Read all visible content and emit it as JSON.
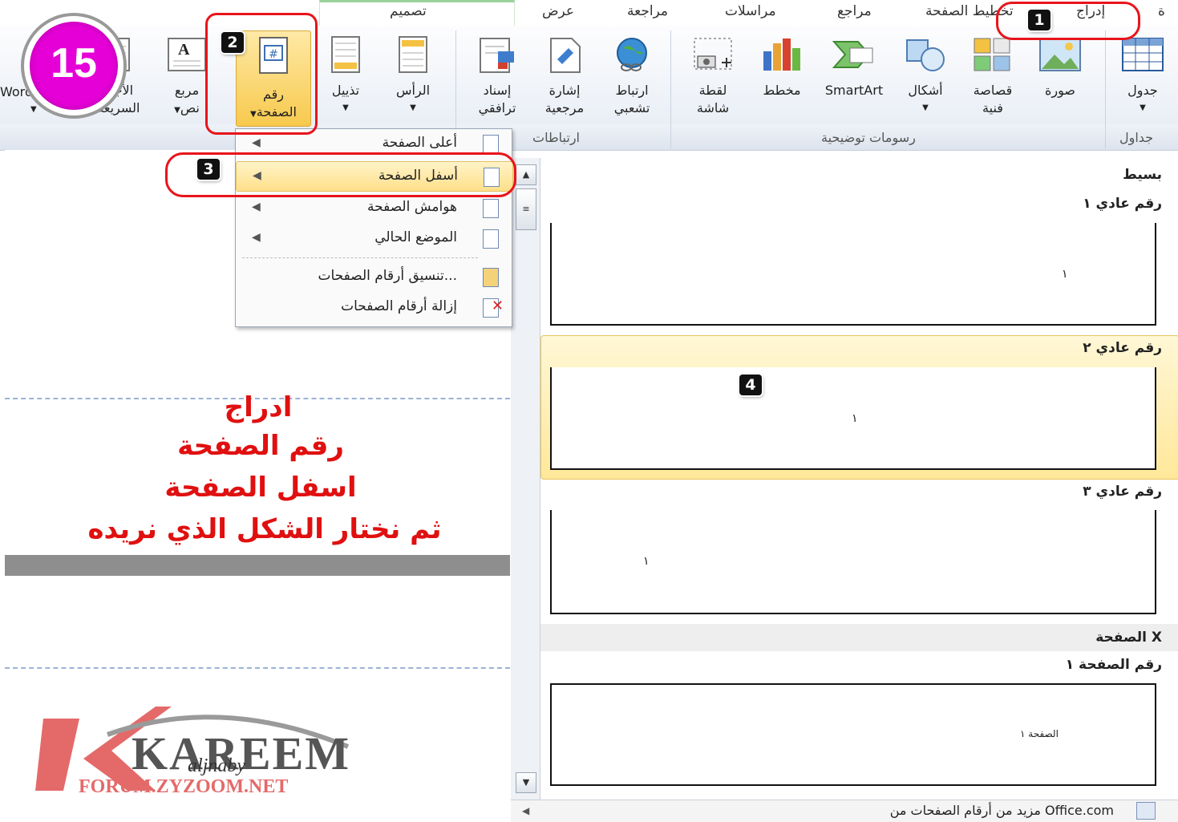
{
  "step_circle": "15",
  "tabs": {
    "design": "تصميم",
    "view": "عرض",
    "review": "مراجعة",
    "mailings": "مراسلات",
    "references": "مراجع",
    "page_layout": "تخطيط الصفحة",
    "insert": "إدراج"
  },
  "ribbon": {
    "table": "جدول",
    "picture": "صورة",
    "clipart": "قصاصة فنية",
    "shapes": "أشكال",
    "smartart": "SmartArt",
    "chart": "مخطط",
    "screenshot": "لقطة شاشة",
    "hyperlink": "ارتباط تشعبي",
    "bookmark": "إشارة مرجعية",
    "crossref": "إسناد ترافقي",
    "header": "الرأس",
    "footer": "تذييل",
    "page_number_line1": "رقم",
    "page_number_line2": "الصفحة",
    "textbox_line1": "مربع",
    "textbox_line2": "نص",
    "quickparts_line1": "الأجزاء",
    "quickparts_line2": "السريعة",
    "wordart": "WordArt",
    "groups": {
      "tables": "جداول",
      "illustrations": "رسومات توضيحية",
      "links": "ارتباطات"
    }
  },
  "menu": {
    "items": [
      {
        "label": "أعلى الصفحة"
      },
      {
        "label": "أسفل الصفحة"
      },
      {
        "label": "هوامش الصفحة"
      },
      {
        "label": "الموضع الحالي"
      },
      {
        "label": "تنسيق أرقام الصفحات..."
      },
      {
        "label": "إزالة أرقام الصفحات"
      }
    ]
  },
  "gallery": {
    "section1": "بسيط",
    "item1": "رقم عادي ١",
    "item2": "رقم عادي ٢",
    "item3": "رقم عادي ٣",
    "section2": "الصفحة X",
    "item4": "رقم الصفحة ١",
    "thumb_digit": "١",
    "thumb4_text": "الصفحة ١",
    "footer_link": "مزيد من أرقام الصفحات من Office.com"
  },
  "badges": {
    "b1": "1",
    "b2": "2",
    "b3": "3",
    "b4": "4"
  },
  "instructions": {
    "line1": "ادراج",
    "line2": "رقم الصفحة",
    "line3": "اسفل الصفحة",
    "line4": "ثم نختار الشكل الذي نريده"
  },
  "watermark": {
    "brand": "KAREEM",
    "script": "aljnaby",
    "url": "FORUM.ZYZOOM.NET"
  },
  "colors": {
    "highlight": "#ffe08a",
    "annotation_red": "#e8141b",
    "circle": "#e600d8"
  }
}
